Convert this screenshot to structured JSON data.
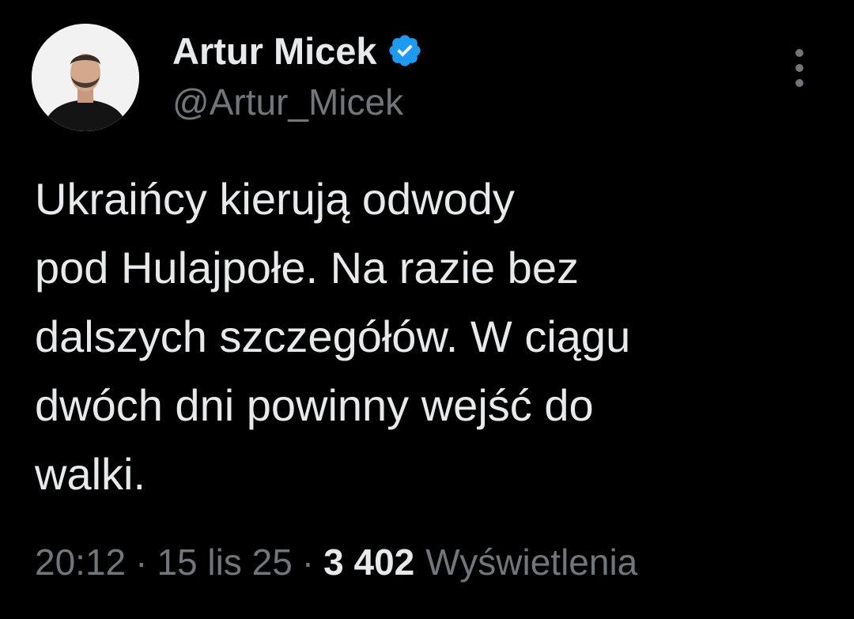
{
  "author": {
    "display_name": "Artur Micek",
    "handle": "@Artur_Micek",
    "verified": true,
    "verified_color": "#1d9bf0"
  },
  "tweet": {
    "text": "Ukraińcy kierują odwody\npod Hulajpołe. Na razie bez\ndalszych szczegółów. W ciągu\ndwóch dni powinny wejść do\nwalki.",
    "time": "20:12",
    "separator": "·",
    "date": "15 lis 25",
    "views_count": "3 402",
    "views_label": "Wyświetlenia"
  },
  "icons": {
    "avatar": "profile-photo",
    "verified": "verified-badge-icon",
    "more": "more-vertical-icon"
  },
  "colors": {
    "background": "#000000",
    "primary_text": "#e7e9ea",
    "secondary_text": "#71767b"
  }
}
